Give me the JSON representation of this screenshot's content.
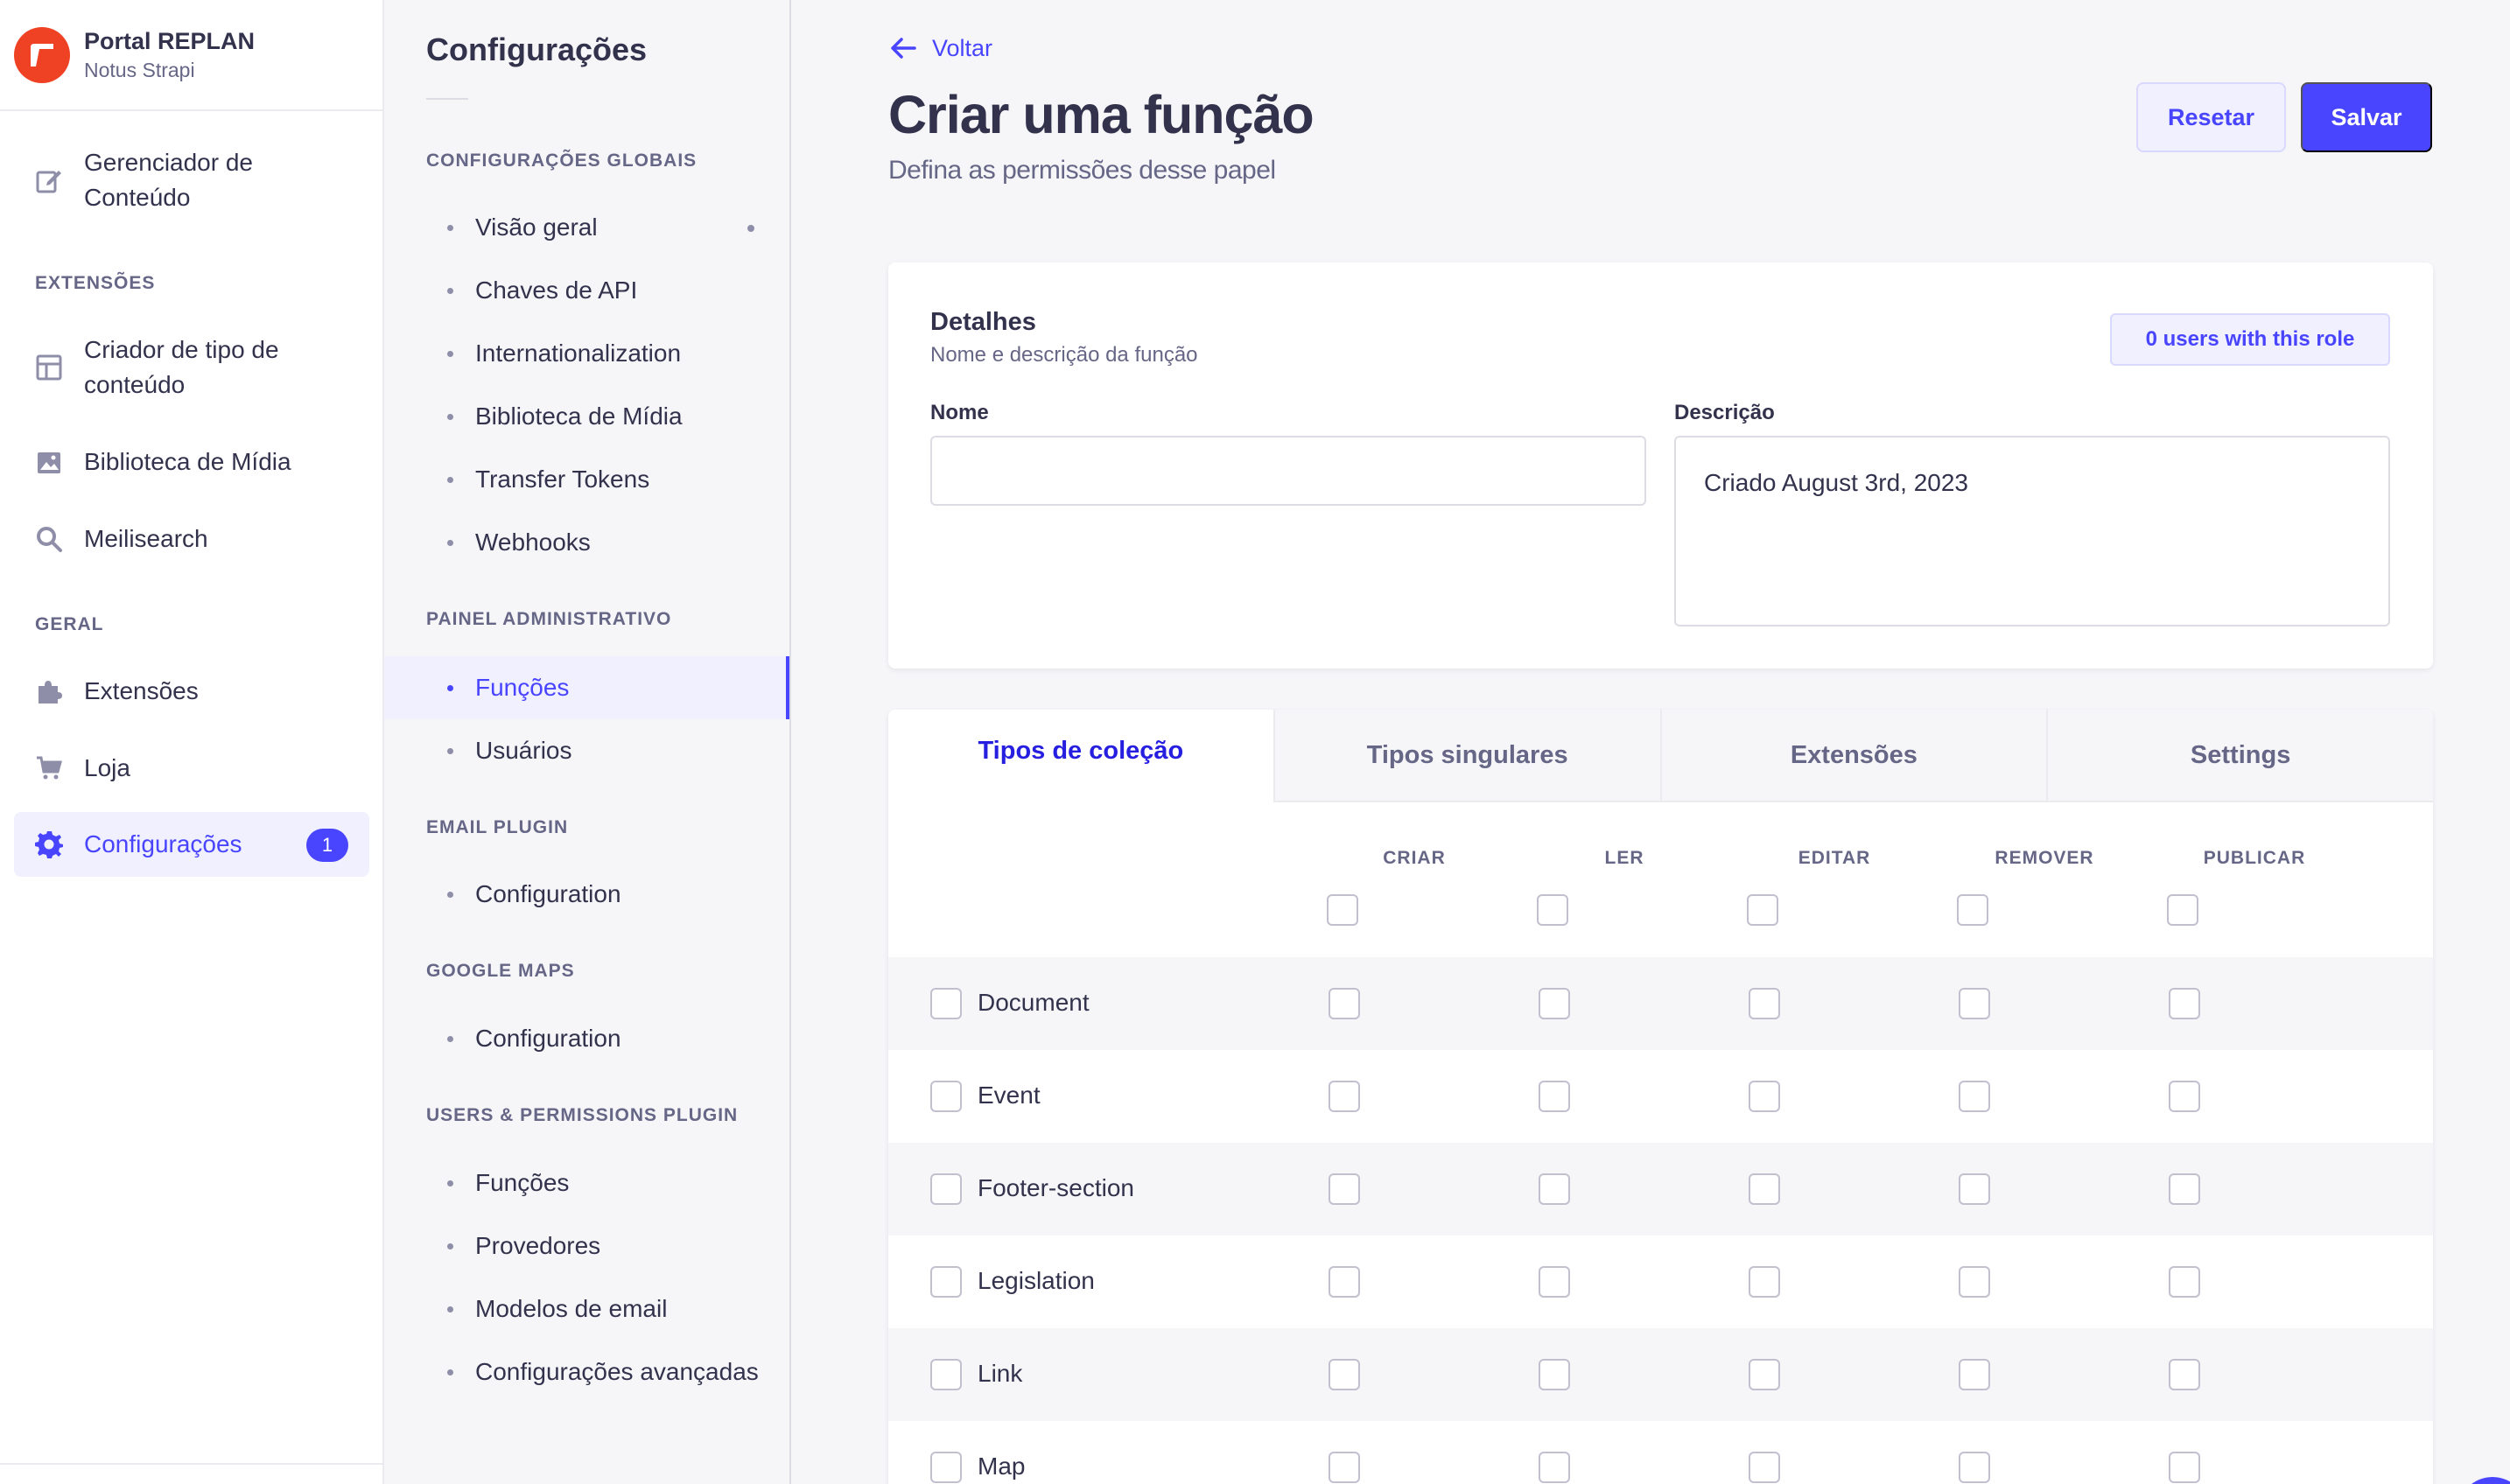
{
  "brand": {
    "title": "Portal REPLAN",
    "subtitle": "Notus Strapi",
    "color": "#ef4123"
  },
  "mainnav": {
    "content_manager": "Gerenciador de Conteúdo",
    "section_extensions": "EXTENSÕES",
    "ctb": "Criador de tipo de conteúdo",
    "media": "Biblioteca de Mídia",
    "meili": "Meilisearch",
    "section_general": "GERAL",
    "plugins": "Extensões",
    "market": "Loja",
    "settings": "Configurações",
    "settings_badge": "1"
  },
  "subnav": {
    "title": "Configurações",
    "global_section": "CONFIGURAÇÕES GLOBAIS",
    "global_items": [
      "Visão geral",
      "Chaves de API",
      "Internationalization",
      "Biblioteca de Mídia",
      "Transfer Tokens",
      "Webhooks"
    ],
    "admin_section": "PAINEL ADMINISTRATIVO",
    "admin_items": [
      "Funções",
      "Usuários"
    ],
    "email_section": "EMAIL PLUGIN",
    "email_items": [
      "Configuration"
    ],
    "gmaps_section": "GOOGLE MAPS",
    "gmaps_items": [
      "Configuration"
    ],
    "up_section": "USERS & PERMISSIONS PLUGIN",
    "up_items": [
      "Funções",
      "Provedores",
      "Modelos de email",
      "Configurações avançadas"
    ]
  },
  "header": {
    "back": "Voltar",
    "title": "Criar uma função",
    "subtitle": "Defina as permissões desse papel",
    "reset": "Resetar",
    "save": "Salvar"
  },
  "details": {
    "title": "Detalhes",
    "subtitle": "Nome e descrição da função",
    "users_badge": "0 users with this role",
    "name_label": "Nome",
    "name_value": "",
    "desc_label": "Descrição",
    "desc_value": "Criado August 3rd, 2023"
  },
  "permissions": {
    "tabs": [
      "Tipos de coleção",
      "Tipos singulares",
      "Extensões",
      "Settings"
    ],
    "columns": [
      "CRIAR",
      "LER",
      "EDITAR",
      "REMOVER",
      "PUBLICAR"
    ],
    "rows": [
      "Document",
      "Event",
      "Footer-section",
      "Legislation",
      "Link",
      "Map"
    ]
  },
  "colors": {
    "primary": "#4945ff",
    "primary_light": "#f0f0ff",
    "text": "#32324d",
    "muted": "#666687"
  }
}
